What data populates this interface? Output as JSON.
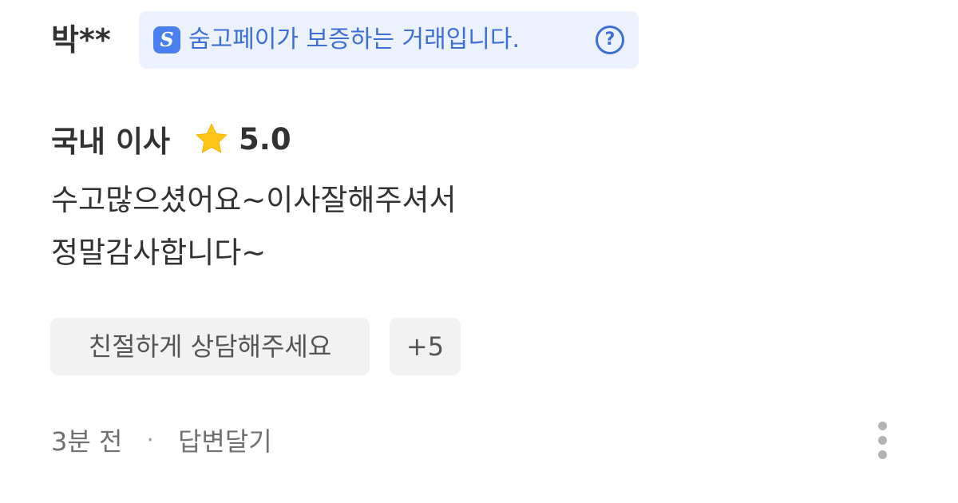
{
  "review": {
    "reviewer_name": "박**",
    "pay_badge": {
      "logo_icon": "soomgo-pay-s-icon",
      "logo_glyph": "S",
      "text": "숨고페이가 보증하는 거래입니다.",
      "help_icon": "question-circle-icon",
      "help_glyph": "?",
      "colors": {
        "background": "#ebf2fd",
        "text": "#3d6fd4",
        "logo": "#4a7ff0"
      }
    },
    "service": "국내 이사",
    "rating_icon": "star-icon",
    "rating": "5.0",
    "body_lines": [
      "수고많으셨어요~이사잘해주셔서",
      "정말감사합니다~"
    ],
    "tags": [
      "친절하게 상담해주세요",
      "+5"
    ],
    "footer": {
      "time_ago": "3분 전",
      "separator": "·",
      "reply_label": "답변달기",
      "more_icon": "more-vertical-icon"
    }
  }
}
